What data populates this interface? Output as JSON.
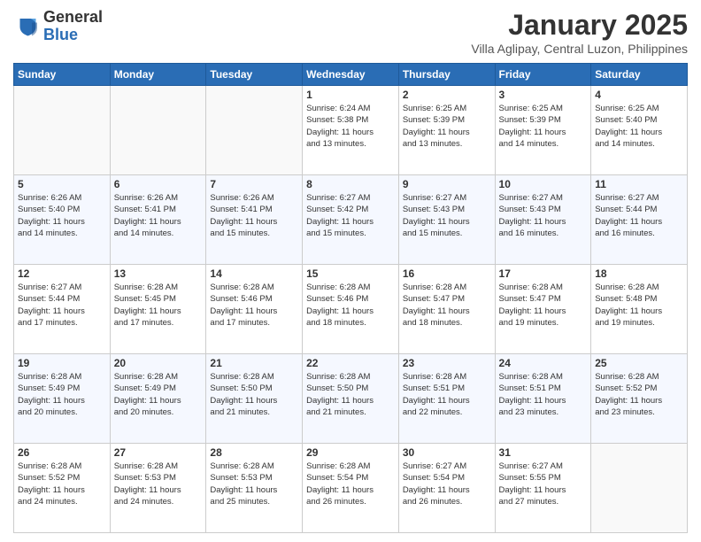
{
  "logo": {
    "general": "General",
    "blue": "Blue"
  },
  "title": "January 2025",
  "location": "Villa Aglipay, Central Luzon, Philippines",
  "days_of_week": [
    "Sunday",
    "Monday",
    "Tuesday",
    "Wednesday",
    "Thursday",
    "Friday",
    "Saturday"
  ],
  "weeks": [
    [
      {
        "day": "",
        "info": ""
      },
      {
        "day": "",
        "info": ""
      },
      {
        "day": "",
        "info": ""
      },
      {
        "day": "1",
        "info": "Sunrise: 6:24 AM\nSunset: 5:38 PM\nDaylight: 11 hours\nand 13 minutes."
      },
      {
        "day": "2",
        "info": "Sunrise: 6:25 AM\nSunset: 5:39 PM\nDaylight: 11 hours\nand 13 minutes."
      },
      {
        "day": "3",
        "info": "Sunrise: 6:25 AM\nSunset: 5:39 PM\nDaylight: 11 hours\nand 14 minutes."
      },
      {
        "day": "4",
        "info": "Sunrise: 6:25 AM\nSunset: 5:40 PM\nDaylight: 11 hours\nand 14 minutes."
      }
    ],
    [
      {
        "day": "5",
        "info": "Sunrise: 6:26 AM\nSunset: 5:40 PM\nDaylight: 11 hours\nand 14 minutes."
      },
      {
        "day": "6",
        "info": "Sunrise: 6:26 AM\nSunset: 5:41 PM\nDaylight: 11 hours\nand 14 minutes."
      },
      {
        "day": "7",
        "info": "Sunrise: 6:26 AM\nSunset: 5:41 PM\nDaylight: 11 hours\nand 15 minutes."
      },
      {
        "day": "8",
        "info": "Sunrise: 6:27 AM\nSunset: 5:42 PM\nDaylight: 11 hours\nand 15 minutes."
      },
      {
        "day": "9",
        "info": "Sunrise: 6:27 AM\nSunset: 5:43 PM\nDaylight: 11 hours\nand 15 minutes."
      },
      {
        "day": "10",
        "info": "Sunrise: 6:27 AM\nSunset: 5:43 PM\nDaylight: 11 hours\nand 16 minutes."
      },
      {
        "day": "11",
        "info": "Sunrise: 6:27 AM\nSunset: 5:44 PM\nDaylight: 11 hours\nand 16 minutes."
      }
    ],
    [
      {
        "day": "12",
        "info": "Sunrise: 6:27 AM\nSunset: 5:44 PM\nDaylight: 11 hours\nand 17 minutes."
      },
      {
        "day": "13",
        "info": "Sunrise: 6:28 AM\nSunset: 5:45 PM\nDaylight: 11 hours\nand 17 minutes."
      },
      {
        "day": "14",
        "info": "Sunrise: 6:28 AM\nSunset: 5:46 PM\nDaylight: 11 hours\nand 17 minutes."
      },
      {
        "day": "15",
        "info": "Sunrise: 6:28 AM\nSunset: 5:46 PM\nDaylight: 11 hours\nand 18 minutes."
      },
      {
        "day": "16",
        "info": "Sunrise: 6:28 AM\nSunset: 5:47 PM\nDaylight: 11 hours\nand 18 minutes."
      },
      {
        "day": "17",
        "info": "Sunrise: 6:28 AM\nSunset: 5:47 PM\nDaylight: 11 hours\nand 19 minutes."
      },
      {
        "day": "18",
        "info": "Sunrise: 6:28 AM\nSunset: 5:48 PM\nDaylight: 11 hours\nand 19 minutes."
      }
    ],
    [
      {
        "day": "19",
        "info": "Sunrise: 6:28 AM\nSunset: 5:49 PM\nDaylight: 11 hours\nand 20 minutes."
      },
      {
        "day": "20",
        "info": "Sunrise: 6:28 AM\nSunset: 5:49 PM\nDaylight: 11 hours\nand 20 minutes."
      },
      {
        "day": "21",
        "info": "Sunrise: 6:28 AM\nSunset: 5:50 PM\nDaylight: 11 hours\nand 21 minutes."
      },
      {
        "day": "22",
        "info": "Sunrise: 6:28 AM\nSunset: 5:50 PM\nDaylight: 11 hours\nand 21 minutes."
      },
      {
        "day": "23",
        "info": "Sunrise: 6:28 AM\nSunset: 5:51 PM\nDaylight: 11 hours\nand 22 minutes."
      },
      {
        "day": "24",
        "info": "Sunrise: 6:28 AM\nSunset: 5:51 PM\nDaylight: 11 hours\nand 23 minutes."
      },
      {
        "day": "25",
        "info": "Sunrise: 6:28 AM\nSunset: 5:52 PM\nDaylight: 11 hours\nand 23 minutes."
      }
    ],
    [
      {
        "day": "26",
        "info": "Sunrise: 6:28 AM\nSunset: 5:52 PM\nDaylight: 11 hours\nand 24 minutes."
      },
      {
        "day": "27",
        "info": "Sunrise: 6:28 AM\nSunset: 5:53 PM\nDaylight: 11 hours\nand 24 minutes."
      },
      {
        "day": "28",
        "info": "Sunrise: 6:28 AM\nSunset: 5:53 PM\nDaylight: 11 hours\nand 25 minutes."
      },
      {
        "day": "29",
        "info": "Sunrise: 6:28 AM\nSunset: 5:54 PM\nDaylight: 11 hours\nand 26 minutes."
      },
      {
        "day": "30",
        "info": "Sunrise: 6:27 AM\nSunset: 5:54 PM\nDaylight: 11 hours\nand 26 minutes."
      },
      {
        "day": "31",
        "info": "Sunrise: 6:27 AM\nSunset: 5:55 PM\nDaylight: 11 hours\nand 27 minutes."
      },
      {
        "day": "",
        "info": ""
      }
    ]
  ]
}
